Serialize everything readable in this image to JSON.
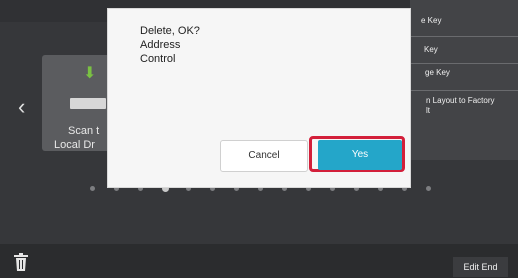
{
  "tile": {
    "label_line1": "Scan t",
    "label_line2": "Local Dr"
  },
  "menu": {
    "items": [
      {
        "label": "e Key"
      },
      {
        "label": "Key"
      },
      {
        "label": "ge Key"
      },
      {
        "label": "n Layout to Factory"
      },
      {
        "label": "lt"
      }
    ]
  },
  "dialog": {
    "line1": "Delete, OK?",
    "line2": "Address",
    "line3": "Control",
    "cancel_label": "Cancel",
    "yes_label": "Yes",
    "highlight_color": "#d31f3a",
    "yes_color": "#24a6c9"
  },
  "footer": {
    "edit_end_label": "Edit End"
  },
  "pagination": {
    "pages": 15,
    "active_index": 3
  }
}
